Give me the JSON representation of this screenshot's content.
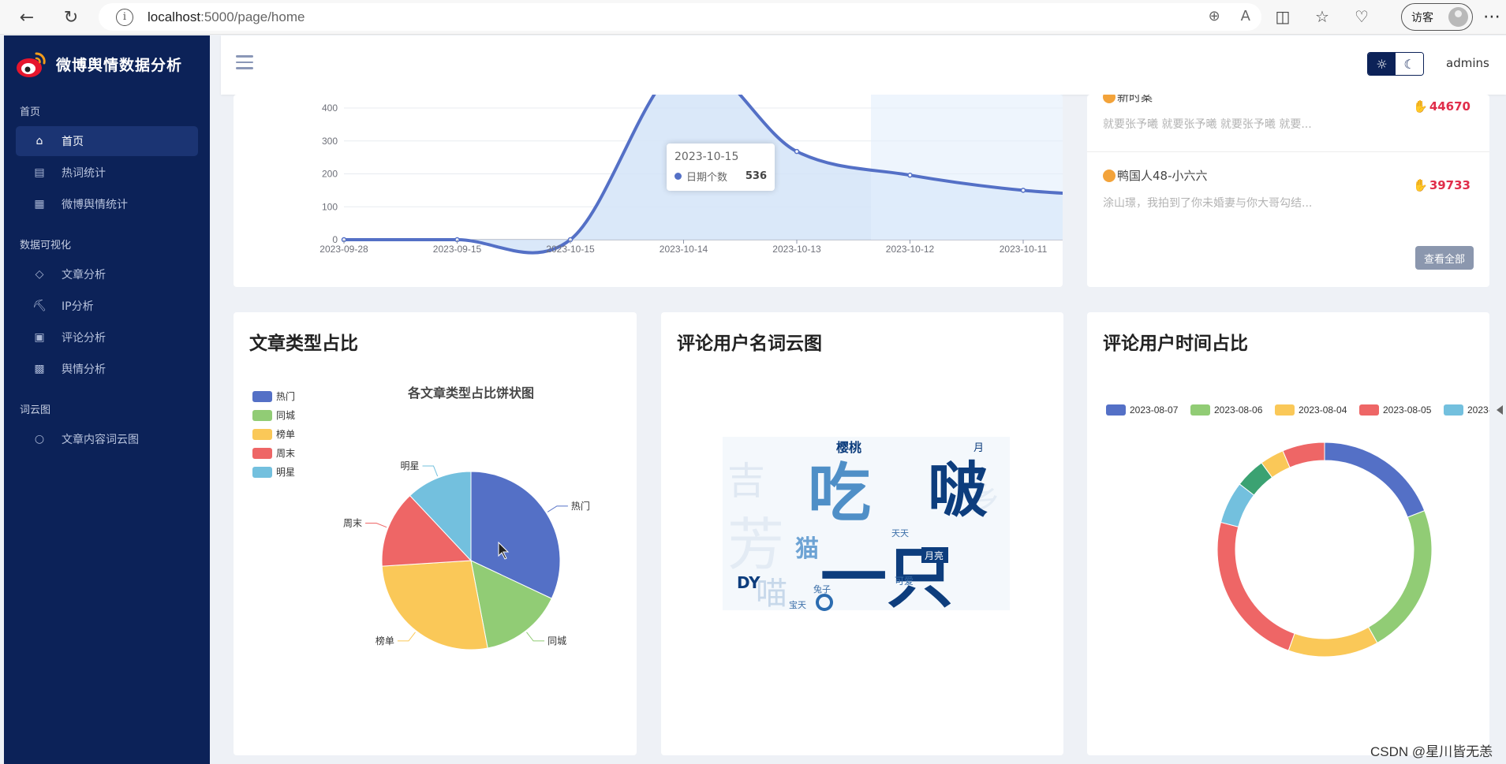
{
  "browser": {
    "url_host": "localhost",
    "url_path": ":5000/page/home",
    "guest_label": "访客"
  },
  "sidebar": {
    "app_title": "微博舆情数据分析",
    "sections": [
      {
        "title": "首页",
        "items": [
          {
            "label": "首页",
            "icon": "home-icon",
            "active": true
          },
          {
            "label": "热词统计",
            "icon": "list-icon"
          },
          {
            "label": "微博舆情统计",
            "icon": "chart-icon"
          }
        ]
      },
      {
        "title": "数据可视化",
        "items": [
          {
            "label": "文章分析",
            "icon": "tag-icon"
          },
          {
            "label": "IP分析",
            "icon": "cart-icon"
          },
          {
            "label": "评论分析",
            "icon": "comment-chart-icon"
          },
          {
            "label": "舆情分析",
            "icon": "clipboard-icon"
          }
        ]
      },
      {
        "title": "词云图",
        "items": [
          {
            "label": "文章内容词云图",
            "icon": "chat-icon"
          }
        ]
      }
    ]
  },
  "header": {
    "username": "admins"
  },
  "line_chart": {
    "tooltip": {
      "date": "2023-10-15",
      "series": "日期个数",
      "value": "536"
    },
    "chart_data": {
      "type": "area",
      "categories": [
        "2023-09-28",
        "2023-09-15",
        "2023-10-15",
        "2023-10-14",
        "2023-10-13",
        "2023-10-12",
        "2023-10-11"
      ],
      "values": [
        0,
        0,
        0,
        536,
        268,
        196,
        150
      ],
      "yticks": [
        "0",
        "100",
        "200",
        "300",
        "400"
      ],
      "ylim": [
        0,
        450
      ],
      "color": "#5470c6",
      "fill": "#d3e4f8"
    }
  },
  "hot_list": {
    "items": [
      {
        "user": "新时案",
        "text": "就要张予曦 就要张予曦 就要张予曦 就要...",
        "likes": "44670"
      },
      {
        "user": "鸭国人48-小六六",
        "text": "涂山璟，我拍到了你未婚妻与你大哥勾结...",
        "likes": "39733"
      }
    ],
    "view_all": "查看全部"
  },
  "pie_card": {
    "title": "文章类型占比",
    "chart_data": {
      "type": "pie",
      "title": "各文章类型占比饼状图",
      "categories": [
        "热门",
        "同城",
        "榜单",
        "周末",
        "明星"
      ],
      "values": [
        32,
        15,
        27,
        14,
        12
      ],
      "colors": [
        "#5470c6",
        "#91cc75",
        "#fac858",
        "#ee6666",
        "#73c0de"
      ]
    }
  },
  "cloud_card": {
    "title": "评论用户名词云图",
    "words": [
      "吃",
      "啵",
      "一只",
      "猫",
      "樱桃",
      "月亮",
      "可爱",
      "兔子",
      "宝天",
      "天天",
      "月"
    ]
  },
  "donut_card": {
    "title": "评论用户时间占比",
    "chart_data": {
      "type": "pie",
      "legend": [
        "2023-08-07",
        "2023-08-06",
        "2023-08-04",
        "2023-08-05",
        "2023-"
      ],
      "values": [
        21,
        25,
        15,
        26,
        7,
        5,
        4,
        7
      ],
      "colors": [
        "#5470c6",
        "#91cc75",
        "#fac858",
        "#ee6666",
        "#73c0de",
        "#3ba272",
        "#fac858",
        "#ee6666"
      ]
    }
  },
  "watermark": "CSDN @星川皆无恙"
}
